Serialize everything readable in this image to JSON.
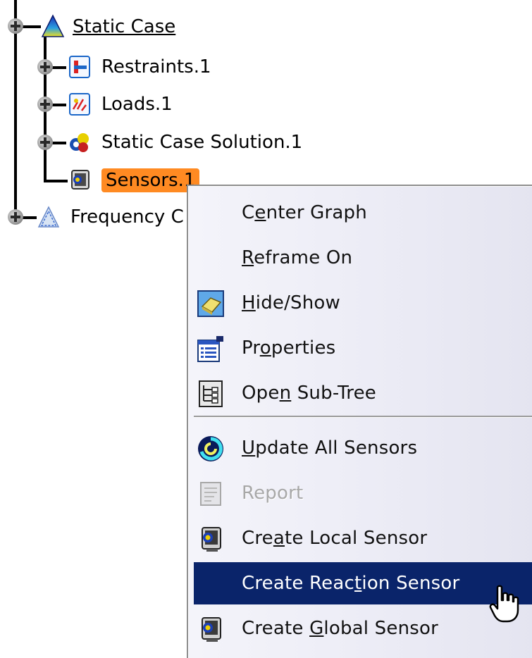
{
  "tree": {
    "items": [
      {
        "label": "Static Case",
        "icon": "static-case-icon"
      },
      {
        "label": "Restraints.1",
        "icon": "restraints-icon"
      },
      {
        "label": "Loads.1",
        "icon": "loads-icon"
      },
      {
        "label": "Static Case Solution.1",
        "icon": "solution-icon"
      },
      {
        "label": "Sensors.1",
        "icon": "sensors-icon"
      },
      {
        "label": "Frequency C",
        "icon": "frequency-case-icon"
      }
    ],
    "selected_color": "#ff8a22"
  },
  "context_menu": {
    "items": [
      {
        "prefix": "C",
        "mnemonic": "e",
        "suffix": "nter Graph",
        "icon": null
      },
      {
        "prefix": "",
        "mnemonic": "R",
        "suffix": "eframe On",
        "icon": null
      },
      {
        "prefix": "",
        "mnemonic": "H",
        "suffix": "ide/Show",
        "icon": "hide-show-icon"
      },
      {
        "prefix": "Pr",
        "mnemonic": "o",
        "suffix": "perties",
        "icon": "properties-icon"
      },
      {
        "prefix": "Ope",
        "mnemonic": "n",
        "suffix": " Sub-Tree",
        "icon": "open-subtree-icon"
      },
      {
        "prefix": "",
        "mnemonic": "U",
        "suffix": "pdate All Sensors",
        "icon": "update-sensors-icon"
      },
      {
        "prefix": "Report",
        "mnemonic": "",
        "suffix": "",
        "icon": "report-icon",
        "disabled": true
      },
      {
        "prefix": "Cre",
        "mnemonic": "a",
        "suffix": "te Local Sensor",
        "icon": "local-sensor-icon"
      },
      {
        "prefix": "Create Reac",
        "mnemonic": "t",
        "suffix": "ion Sensor",
        "icon": null,
        "highlighted": true
      },
      {
        "prefix": "Create ",
        "mnemonic": "G",
        "suffix": "lobal Sensor",
        "icon": "global-sensor-icon"
      }
    ],
    "highlight_color": "#0a246a"
  }
}
